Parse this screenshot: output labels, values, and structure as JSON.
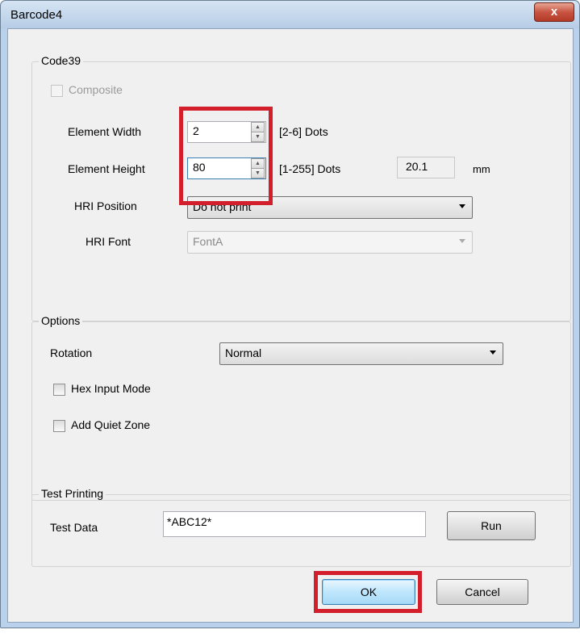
{
  "window": {
    "title": "Barcode4",
    "close_glyph": "x"
  },
  "code39": {
    "group_label": "Code39",
    "composite_label": "Composite",
    "element_width": {
      "label": "Element Width",
      "value": "2",
      "range": "[2-6] Dots"
    },
    "element_height": {
      "label": "Element Height",
      "value": "80",
      "range": "[1-255] Dots",
      "mm_value": "20.1",
      "mm_unit": "mm"
    },
    "hri_position": {
      "label": "HRI Position",
      "selected": "Do not print"
    },
    "hri_font": {
      "label": "HRI Font",
      "selected": "FontA"
    }
  },
  "options": {
    "group_label": "Options",
    "rotation": {
      "label": "Rotation",
      "selected": "Normal"
    },
    "hex_input_label": "Hex Input Mode",
    "quiet_zone_label": "Add Quiet Zone"
  },
  "test_printing": {
    "group_label": "Test Printing",
    "test_data_label": "Test Data",
    "test_data_value": "*ABC12*",
    "run_label": "Run"
  },
  "buttons": {
    "ok_label": "OK",
    "cancel_label": "Cancel"
  },
  "colors": {
    "highlight": "#d21f2b"
  }
}
